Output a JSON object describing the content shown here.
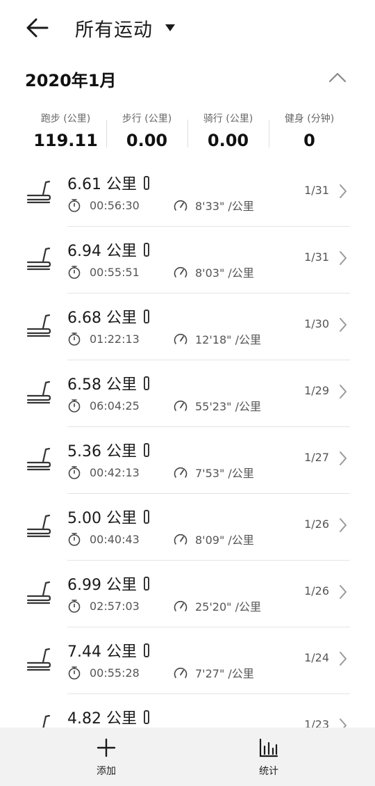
{
  "header": {
    "title": "所有运动",
    "back_icon": "arrow-left-icon",
    "caret_icon": "caret-down-icon"
  },
  "month": {
    "label": "2020年1月",
    "collapse_icon": "chevron-up-icon"
  },
  "summary": [
    {
      "label": "跑步 (公里)",
      "value": "119.11"
    },
    {
      "label": "步行 (公里)",
      "value": "0.00"
    },
    {
      "label": "骑行 (公里)",
      "value": "0.00"
    },
    {
      "label": "健身 (分钟)",
      "value": "0"
    }
  ],
  "records": [
    {
      "distance": "6.61 公里",
      "duration": "00:56:30",
      "pace": "8'33\" /公里",
      "date": "1/31"
    },
    {
      "distance": "6.94 公里",
      "duration": "00:55:51",
      "pace": "8'03\" /公里",
      "date": "1/31"
    },
    {
      "distance": "6.68 公里",
      "duration": "01:22:13",
      "pace": "12'18\" /公里",
      "date": "1/30"
    },
    {
      "distance": "6.58 公里",
      "duration": "06:04:25",
      "pace": "55'23\" /公里",
      "date": "1/29"
    },
    {
      "distance": "5.36 公里",
      "duration": "00:42:13",
      "pace": "7'53\" /公里",
      "date": "1/27"
    },
    {
      "distance": "5.00 公里",
      "duration": "00:40:43",
      "pace": "8'09\" /公里",
      "date": "1/26"
    },
    {
      "distance": "6.99 公里",
      "duration": "02:57:03",
      "pace": "25'20\" /公里",
      "date": "1/26"
    },
    {
      "distance": "7.44 公里",
      "duration": "00:55:28",
      "pace": "7'27\" /公里",
      "date": "1/24"
    },
    {
      "distance": "4.82 公里",
      "duration": "",
      "pace": "",
      "date": "1/23"
    }
  ],
  "icons": {
    "activity": "treadmill-icon",
    "device": "band-icon",
    "duration": "stopwatch-icon",
    "pace": "speedometer-icon",
    "open": "chevron-right-icon"
  },
  "bottom_bar": {
    "add_label": "添加",
    "stats_label": "统计"
  },
  "colors": {
    "text": "#1a1a1a",
    "secondary": "#555555",
    "bar_background": "#f2f2f2"
  }
}
